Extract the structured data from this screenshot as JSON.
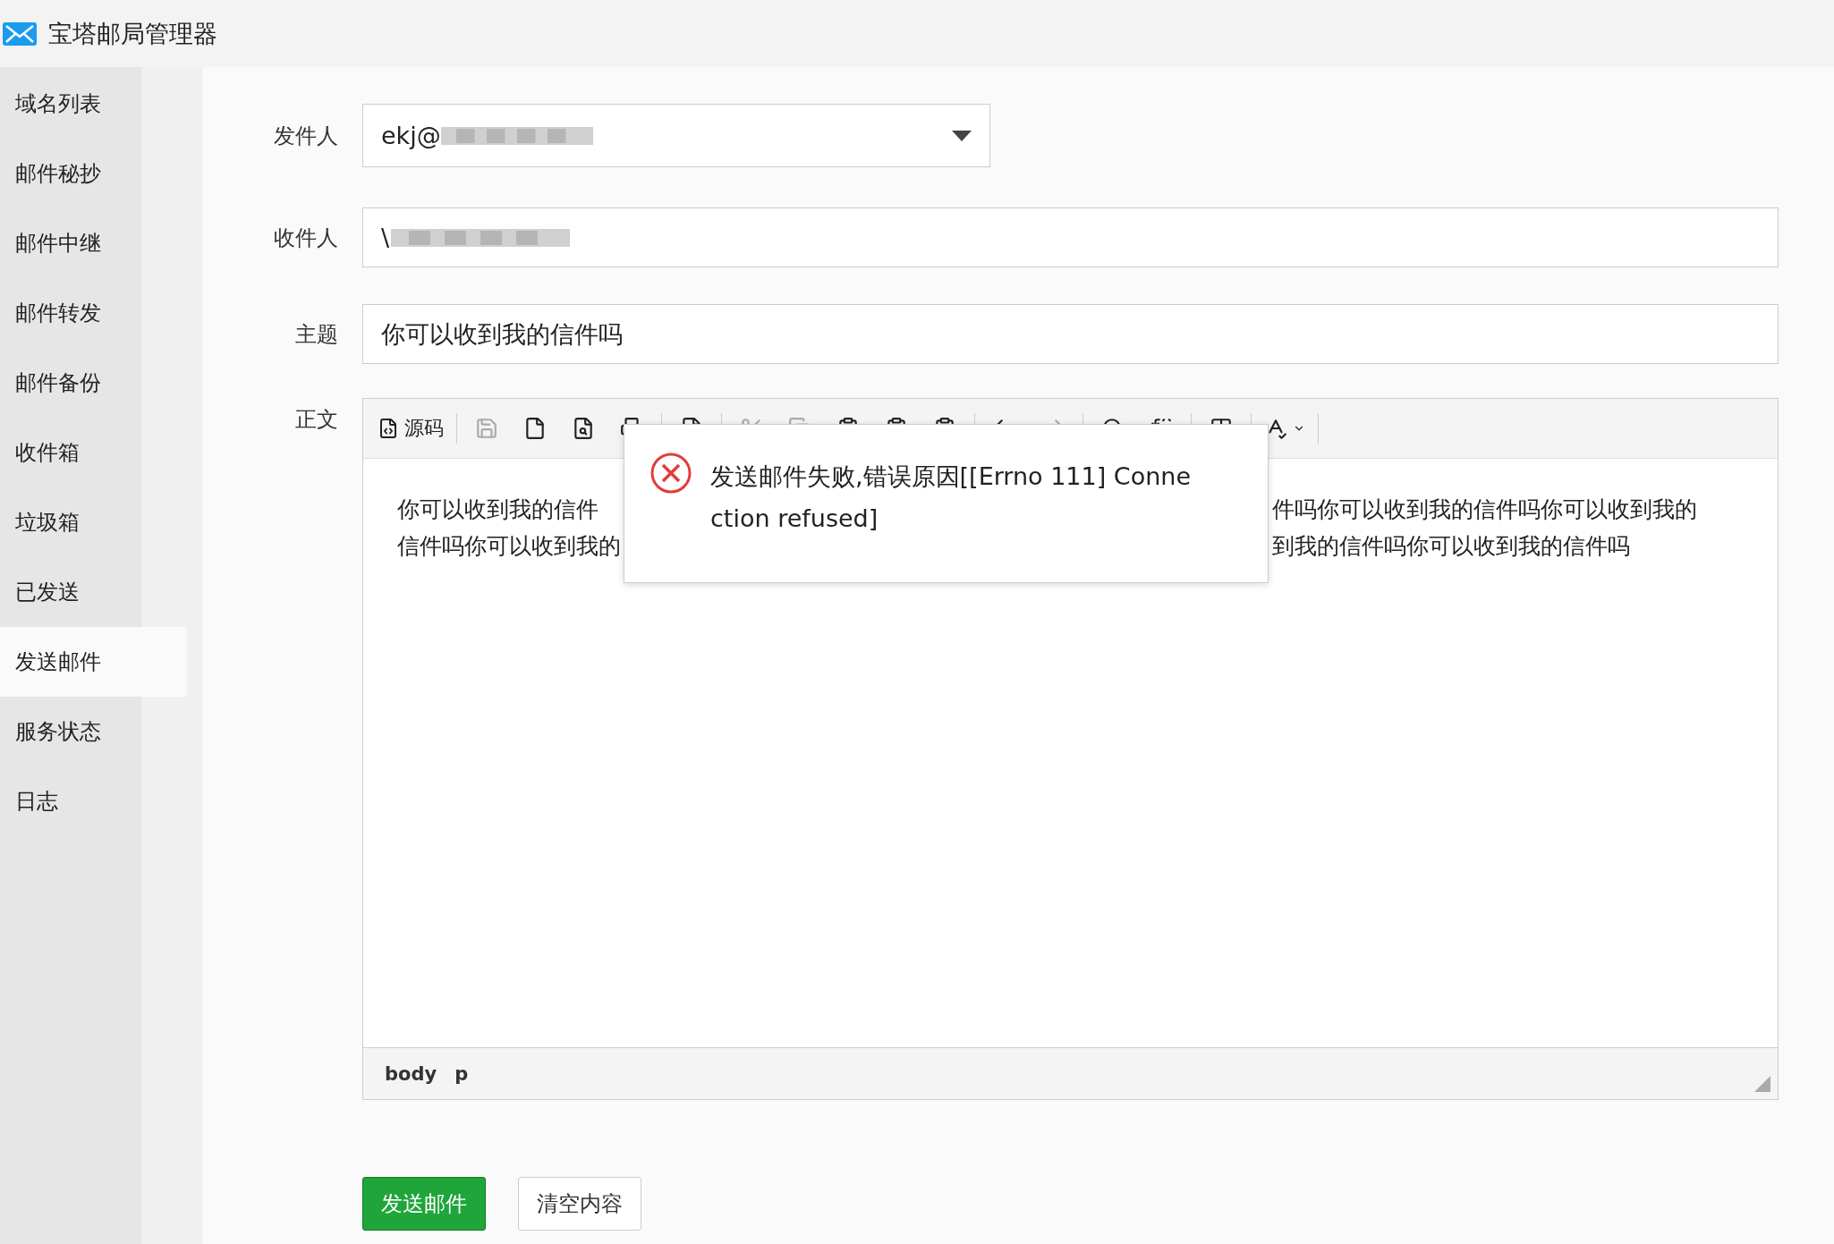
{
  "app": {
    "title": "宝塔邮局管理器"
  },
  "sidebar": {
    "items": [
      {
        "label": "域名列表",
        "selected": false
      },
      {
        "label": "邮件秘抄",
        "selected": false
      },
      {
        "label": "邮件中继",
        "selected": false
      },
      {
        "label": "邮件转发",
        "selected": false
      },
      {
        "label": "邮件备份",
        "selected": false
      },
      {
        "label": "收件箱",
        "selected": false
      },
      {
        "label": "垃圾箱",
        "selected": false
      },
      {
        "label": "已发送",
        "selected": false
      },
      {
        "label": "发送邮件",
        "selected": true
      },
      {
        "label": "服务状态",
        "selected": false
      },
      {
        "label": "日志",
        "selected": false
      }
    ]
  },
  "form": {
    "sender": {
      "label": "发件人",
      "value": "ekj@"
    },
    "recipient": {
      "label": "收件人",
      "value": "\\"
    },
    "subject": {
      "label": "主题",
      "value": "你可以收到我的信件吗"
    },
    "body_label": "正文"
  },
  "editor": {
    "source_button": "源码",
    "text_left": [
      "你可以收到我的信件",
      "信件吗你可以收到我的"
    ],
    "text_right": [
      "件吗你可以收到我的信件吗你可以收到我的",
      "到我的信件吗你可以收到我的信件吗"
    ],
    "path": [
      "body",
      "p"
    ]
  },
  "dialog": {
    "message": "发送邮件失败,错误原因[[Errno 111] Connection refused]"
  },
  "buttons": [
    {
      "label": "发送邮件",
      "kind": "primary"
    },
    {
      "label": "清空内容",
      "kind": "secondary"
    }
  ]
}
